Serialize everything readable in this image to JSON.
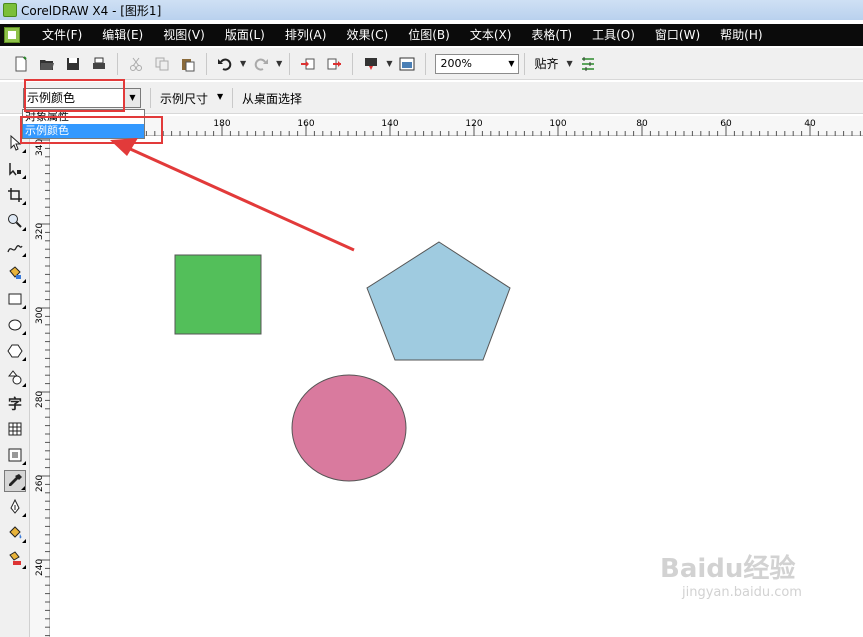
{
  "window": {
    "title": "CorelDRAW X4 - [图形1]"
  },
  "menu": {
    "items": [
      "文件(F)",
      "编辑(E)",
      "视图(V)",
      "版面(L)",
      "排列(A)",
      "效果(C)",
      "位图(B)",
      "文本(X)",
      "表格(T)",
      "工具(O)",
      "窗口(W)",
      "帮助(H)"
    ]
  },
  "toolbar": {
    "zoom_value": "200%",
    "snap_label": "贴齐"
  },
  "property_bar": {
    "selected_option": "示例颜色",
    "sample_size_label": "示例尺寸",
    "select_from_desktop_label": "从桌面选择",
    "dropdown_options": [
      "对象属性",
      "示例颜色"
    ]
  },
  "rulers": {
    "top_ticks": [
      "180",
      "160",
      "140",
      "120",
      "100",
      "80",
      "60",
      "40"
    ],
    "left_ticks": [
      "340",
      "320",
      "300",
      "280",
      "260",
      "240"
    ]
  },
  "canvas": {
    "shapes": [
      {
        "name": "green-square",
        "type": "rect",
        "fill": "#53bf5a"
      },
      {
        "name": "blue-pentagon",
        "type": "pentagon",
        "fill": "#9fcbe0"
      },
      {
        "name": "pink-ellipse",
        "type": "ellipse",
        "fill": "#d97a9e"
      }
    ]
  },
  "colors": {
    "highlight": "#e23a3a",
    "selection": "#3399ff"
  },
  "watermark": {
    "logo": "Baidu经验",
    "url": "jingyan.baidu.com"
  }
}
